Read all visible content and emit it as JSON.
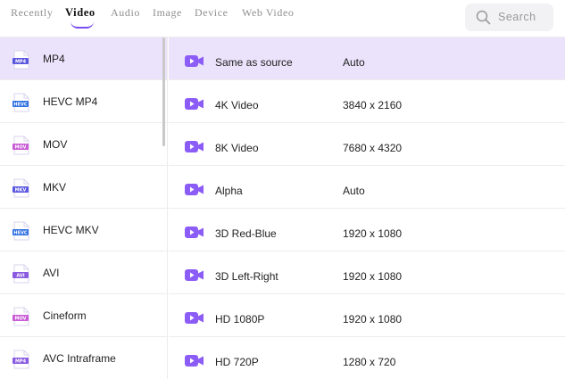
{
  "tabs": [
    {
      "label": "Recently"
    },
    {
      "label": "Video"
    },
    {
      "label": "Audio"
    },
    {
      "label": "Image"
    },
    {
      "label": "Device"
    },
    {
      "label": "Web Video"
    }
  ],
  "active_tab": "Video",
  "search": {
    "placeholder": "Search"
  },
  "colors": {
    "accent": "#7a4df0",
    "selected_row": "#ebe3fb",
    "video_icon": "#8b5cf6"
  },
  "formats": [
    {
      "label": "MP4",
      "icon_text": "MP4",
      "icon_color": "#5b57e0",
      "selected": true
    },
    {
      "label": "HEVC MP4",
      "icon_text": "HEVC",
      "icon_color": "#2f6fe0"
    },
    {
      "label": "MOV",
      "icon_text": "MOV",
      "icon_color": "#c95bd6"
    },
    {
      "label": "MKV",
      "icon_text": "MKV",
      "icon_color": "#5b57e0"
    },
    {
      "label": "HEVC MKV",
      "icon_text": "HEVC",
      "icon_color": "#2f6fe0"
    },
    {
      "label": "AVI",
      "icon_text": "AVI",
      "icon_color": "#8a5be0"
    },
    {
      "label": "Cineform",
      "icon_text": "MOV",
      "icon_color": "#c95bd6"
    },
    {
      "label": "AVC Intraframe",
      "icon_text": "MP4",
      "icon_color": "#8a5be0"
    }
  ],
  "presets": [
    {
      "name": "Same as source",
      "resolution": "Auto",
      "selected": true
    },
    {
      "name": "4K Video",
      "resolution": "3840 x 2160"
    },
    {
      "name": "8K Video",
      "resolution": "7680 x 4320"
    },
    {
      "name": "Alpha",
      "resolution": "Auto"
    },
    {
      "name": "3D Red-Blue",
      "resolution": "1920 x 1080"
    },
    {
      "name": "3D Left-Right",
      "resolution": "1920 x 1080"
    },
    {
      "name": "HD 1080P",
      "resolution": "1920 x 1080"
    },
    {
      "name": "HD 720P",
      "resolution": "1280 x 720"
    }
  ]
}
